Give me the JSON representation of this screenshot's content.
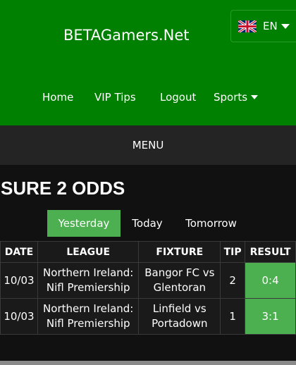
{
  "header": {
    "brand": "BETAGamers.Net",
    "language": {
      "label": "EN",
      "flag_icon": "uk-flag-icon"
    },
    "nav": [
      {
        "label": "Home"
      },
      {
        "label": "VIP Tips"
      },
      {
        "label": "Logout"
      },
      {
        "label": "Sports",
        "has_dropdown": true
      }
    ]
  },
  "menu": {
    "label": "MENU"
  },
  "main": {
    "title": "SURE 2 ODDS",
    "day_tabs": [
      {
        "label": "Yesterday",
        "active": true
      },
      {
        "label": "Today",
        "active": false
      },
      {
        "label": "Tomorrow",
        "active": false
      }
    ],
    "table": {
      "headers": [
        "DATE",
        "LEAGUE",
        "FIXTURE",
        "TIP",
        "RESULT"
      ],
      "rows": [
        {
          "date": "10/03",
          "league": "Northern Ireland: Nifl Premiership",
          "fixture": "Bangor FC vs Glentoran",
          "tip": "2",
          "result": "0:4"
        },
        {
          "date": "10/03",
          "league": "Northern Ireland: Nifl Premiership",
          "fixture": "Linfield vs Portadown",
          "tip": "1",
          "result": "3:1"
        }
      ]
    }
  },
  "colors": {
    "header_green": "#008000",
    "accent_green": "#4caf50",
    "menu_bar": "#242424",
    "background": "#111111"
  }
}
